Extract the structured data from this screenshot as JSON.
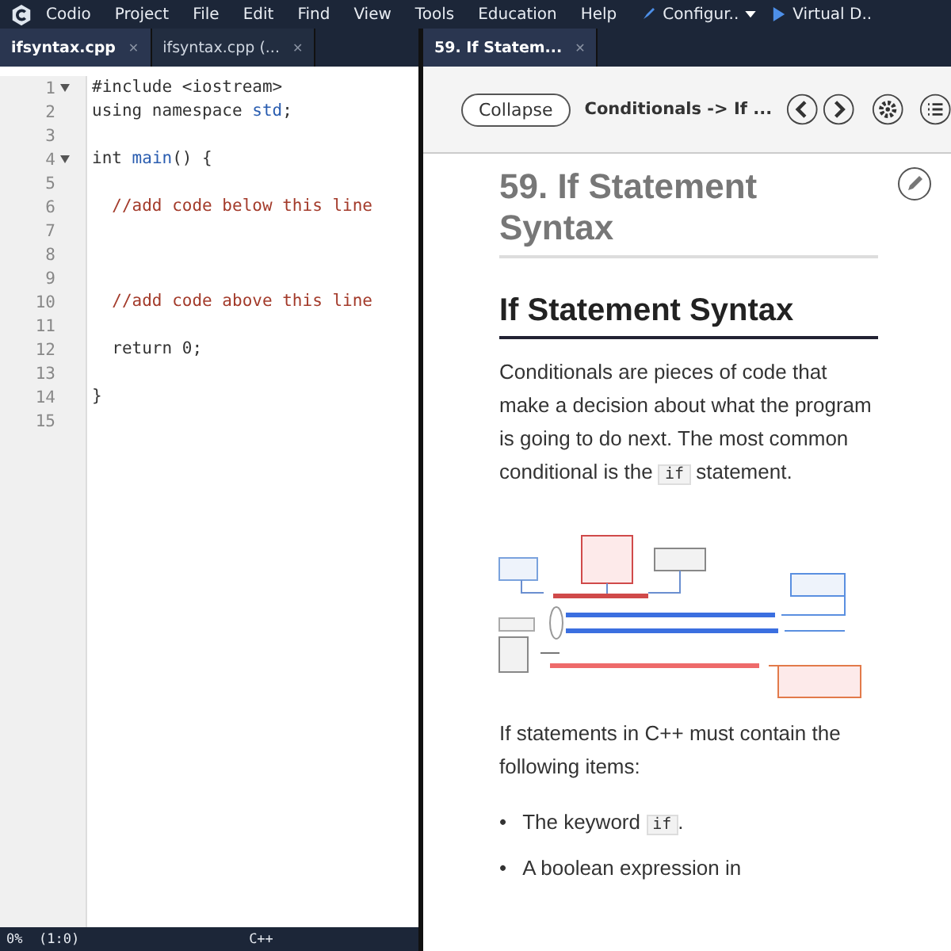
{
  "menu_bar": {
    "items": [
      "Codio",
      "Project",
      "File",
      "Edit",
      "Find",
      "View",
      "Tools",
      "Education",
      "Help"
    ],
    "configure": "Configur..",
    "virtual": "Virtual D.."
  },
  "editor_tabs": [
    {
      "label": "ifsyntax.cpp",
      "selected": true,
      "close": "✕"
    },
    {
      "label": "ifsyntax.cpp (...",
      "selected": false,
      "close": "✕"
    }
  ],
  "guide_tabs": [
    {
      "label": "59. If Statem...",
      "selected": true,
      "close": "✕"
    }
  ],
  "code_lines": [
    {
      "number": "1",
      "fold": true,
      "tokens": [
        {
          "text": "#include <iostream>",
          "kind": "plain"
        }
      ]
    },
    {
      "number": "2",
      "fold": false,
      "tokens": [
        {
          "text": "using namespace ",
          "kind": "plain"
        },
        {
          "text": "std",
          "kind": "name"
        },
        {
          "text": ";",
          "kind": "plain"
        }
      ]
    },
    {
      "number": "3",
      "fold": false
    },
    {
      "number": "4",
      "fold": true,
      "tokens": [
        {
          "text": "int ",
          "kind": "plain"
        },
        {
          "text": "main",
          "kind": "name"
        },
        {
          "text": "() {",
          "kind": "plain"
        }
      ]
    },
    {
      "number": "5",
      "fold": false
    },
    {
      "number": "6",
      "fold": false,
      "tokens": [
        {
          "text": "  //add code below this line",
          "kind": "comment"
        }
      ]
    },
    {
      "number": "7",
      "fold": false
    },
    {
      "number": "8",
      "fold": false
    },
    {
      "number": "9",
      "fold": false
    },
    {
      "number": "10",
      "fold": false,
      "tokens": [
        {
          "text": "  //add code above this line",
          "kind": "comment"
        }
      ]
    },
    {
      "number": "11",
      "fold": false
    },
    {
      "number": "12",
      "fold": false,
      "tokens": [
        {
          "text": "  return 0;",
          "kind": "plain"
        }
      ]
    },
    {
      "number": "13",
      "fold": false
    },
    {
      "number": "14",
      "fold": false,
      "tokens": [
        {
          "text": "}",
          "kind": "plain"
        }
      ]
    },
    {
      "number": "15",
      "fold": false
    }
  ],
  "status_bar": {
    "position": "0%  (1:0)",
    "language": "C++"
  },
  "guide": {
    "collapse": "Collapse",
    "breadcrumb": "Conditionals -> If ...",
    "page_title": "59. If Statement Syntax",
    "heading": "If Statement Syntax",
    "intro": [
      {
        "text": "Conditionals are pieces of code that make a decision about what the program is going to do next. The most common conditional is the ",
        "kind": "text"
      },
      {
        "text": "if",
        "kind": "code"
      },
      {
        "text": " statement.",
        "kind": "text"
      }
    ],
    "after": "If statements in C++ must contain the following items:",
    "bullets": [
      {
        "marker": "•",
        "parts": [
          {
            "text": "The keyword ",
            "kind": "text"
          },
          {
            "text": "if",
            "kind": "code"
          },
          {
            "text": ".",
            "kind": "text"
          }
        ]
      },
      {
        "marker": "•",
        "parts": [
          {
            "text": "A boolean expression in",
            "kind": "text"
          }
        ]
      }
    ]
  }
}
